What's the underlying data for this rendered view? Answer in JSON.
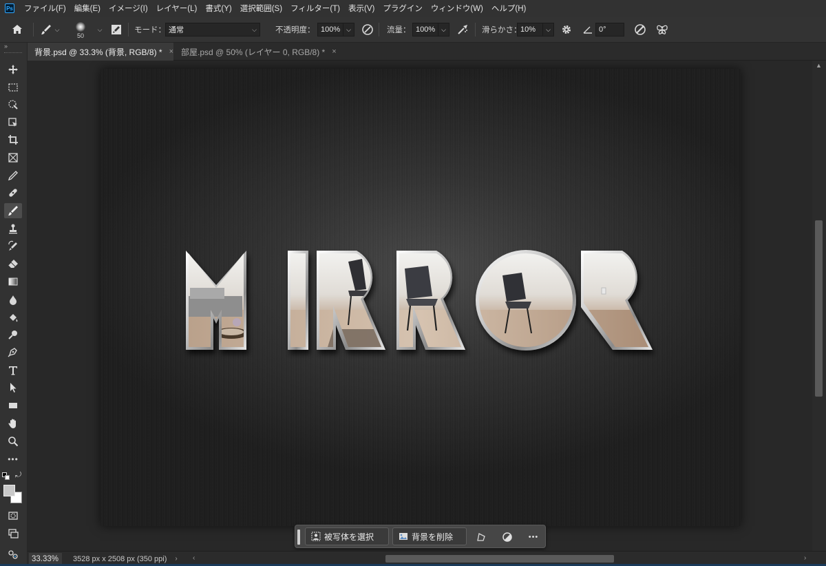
{
  "app": {
    "logo": "Ps"
  },
  "menu": [
    "ファイル(F)",
    "編集(E)",
    "イメージ(I)",
    "レイヤー(L)",
    "書式(Y)",
    "選択範囲(S)",
    "フィルター(T)",
    "表示(V)",
    "プラグイン",
    "ウィンドウ(W)",
    "ヘルプ(H)"
  ],
  "options": {
    "brush_size": "50",
    "mode_label": "モード：",
    "mode_value": "通常",
    "opacity_label": "不透明度：",
    "opacity_value": "100%",
    "flow_label": "流量：",
    "flow_value": "100%",
    "smoothing_label": "滑らかさ：",
    "smoothing_value": "10%",
    "angle_value": "0°"
  },
  "tabs": [
    {
      "label": "背景.psd @ 33.3% (背景, RGB/8) *",
      "close": "×"
    },
    {
      "label": "部屋.psd @ 50% (レイヤー 0, RGB/8) *",
      "close": "×"
    }
  ],
  "canvas": {
    "text": "MIRROR"
  },
  "taskbar": {
    "select_subject": "被写体を選択",
    "remove_background": "背景を削除",
    "more": "•••"
  },
  "status": {
    "zoom": "33.33%",
    "doc_info": "3528 px x 2508 px (350 ppi)",
    "arrow": "›"
  },
  "colors": {
    "accent": "#31a8ff",
    "panel": "#323232",
    "canvas_bg": "#282828"
  }
}
